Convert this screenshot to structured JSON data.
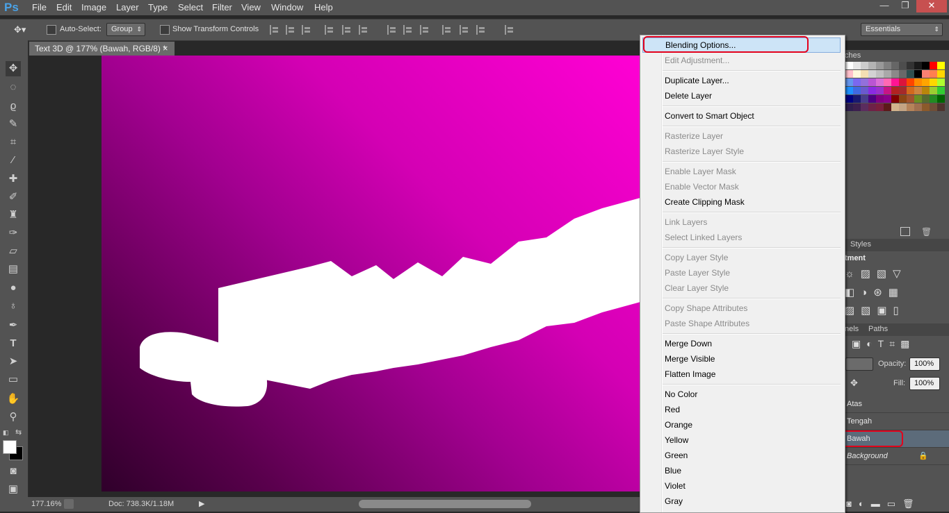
{
  "app": {
    "logo": "Ps"
  },
  "menubar": {
    "items": [
      "File",
      "Edit",
      "Image",
      "Layer",
      "Type",
      "Select",
      "Filter",
      "View",
      "Window",
      "Help"
    ]
  },
  "window_controls": {
    "minimize": "—",
    "restore": "❐",
    "close": "✕"
  },
  "options_bar": {
    "auto_select_label": "Auto-Select:",
    "auto_select_value": "Group",
    "show_transform_label": "Show Transform Controls",
    "workspace_value": "Essentials"
  },
  "document": {
    "tab_title": "Text 3D @ 177% (Bawah, RGB/8) *",
    "close_glyph": "×"
  },
  "status_bar": {
    "zoom": "177.16%",
    "doc_info": "Doc: 738.3K/1.18M"
  },
  "panels": {
    "swatches_tab": "ches",
    "styles_tab": "Styles",
    "adjustments_title": "tment",
    "channels_tab": "nels",
    "paths_tab": "Paths",
    "opacity_label": "Opacity:",
    "opacity_value": "100%",
    "fill_label": "Fill:",
    "fill_value": "100%",
    "layers": [
      {
        "name": "Atas",
        "selected": false,
        "italic": false
      },
      {
        "name": "Tengah",
        "selected": false,
        "italic": false
      },
      {
        "name": "Bawah",
        "selected": true,
        "italic": false
      },
      {
        "name": "Background",
        "selected": false,
        "italic": true
      }
    ]
  },
  "context_menu": {
    "groups": [
      [
        {
          "label": "Blending Options...",
          "enabled": true,
          "highlighted": true
        },
        {
          "label": "Edit Adjustment...",
          "enabled": false
        }
      ],
      [
        {
          "label": "Duplicate Layer...",
          "enabled": true
        },
        {
          "label": "Delete Layer",
          "enabled": true
        }
      ],
      [
        {
          "label": "Convert to Smart Object",
          "enabled": true
        }
      ],
      [
        {
          "label": "Rasterize Layer",
          "enabled": false
        },
        {
          "label": "Rasterize Layer Style",
          "enabled": false
        }
      ],
      [
        {
          "label": "Enable Layer Mask",
          "enabled": false
        },
        {
          "label": "Enable Vector Mask",
          "enabled": false
        },
        {
          "label": "Create Clipping Mask",
          "enabled": true
        }
      ],
      [
        {
          "label": "Link Layers",
          "enabled": false
        },
        {
          "label": "Select Linked Layers",
          "enabled": false
        }
      ],
      [
        {
          "label": "Copy Layer Style",
          "enabled": false
        },
        {
          "label": "Paste Layer Style",
          "enabled": false
        },
        {
          "label": "Clear Layer Style",
          "enabled": false
        }
      ],
      [
        {
          "label": "Copy Shape Attributes",
          "enabled": false
        },
        {
          "label": "Paste Shape Attributes",
          "enabled": false
        }
      ],
      [
        {
          "label": "Merge Down",
          "enabled": true
        },
        {
          "label": "Merge Visible",
          "enabled": true
        },
        {
          "label": "Flatten Image",
          "enabled": true
        }
      ],
      [
        {
          "label": "No Color",
          "enabled": true
        },
        {
          "label": "Red",
          "enabled": true
        },
        {
          "label": "Orange",
          "enabled": true
        },
        {
          "label": "Yellow",
          "enabled": true
        },
        {
          "label": "Green",
          "enabled": true
        },
        {
          "label": "Blue",
          "enabled": true
        },
        {
          "label": "Violet",
          "enabled": true
        },
        {
          "label": "Gray",
          "enabled": true
        }
      ]
    ]
  },
  "colors": {
    "highlight_outline": "#e3001b",
    "menu_highlight": "#cde4f7",
    "selected_layer": "#5c6b7a"
  }
}
